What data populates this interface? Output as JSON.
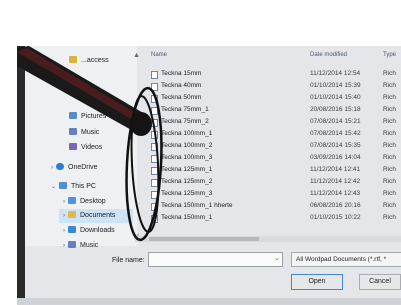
{
  "nav": {
    "items": [
      {
        "label": "...access",
        "color": "#d9b23c"
      },
      {
        "label": "Pictures",
        "color": "#5a8bc9"
      },
      {
        "label": "Music",
        "color": "#6a7fbf"
      },
      {
        "label": "Videos",
        "color": "#7b65b5"
      },
      {
        "label": "OneDrive",
        "color": "#2a7fd4"
      },
      {
        "label": "This PC",
        "color": "#4f8ed6"
      },
      {
        "label": "Desktop",
        "color": "#4a96da"
      },
      {
        "label": "Documents",
        "color": "#dfb94a"
      },
      {
        "label": "Downloads",
        "color": "#3a8ad2"
      },
      {
        "label": "Music",
        "color": "#6a7fbf"
      }
    ]
  },
  "columns": {
    "name": "Name",
    "date": "Date modified",
    "type": "Type"
  },
  "files": [
    {
      "name": "Teckna 15mm",
      "date": "11/12/2014 12:54",
      "type": "Rich"
    },
    {
      "name": "Teckna 40mm",
      "date": "01/10/2014 15:39",
      "type": "Rich"
    },
    {
      "name": "Teckna 50mm",
      "date": "01/10/2014 15:40",
      "type": "Rich"
    },
    {
      "name": "Teckna 75mm_1",
      "date": "20/08/2016 15:18",
      "type": "Rich"
    },
    {
      "name": "Teckna 75mm_2",
      "date": "07/08/2014 15:21",
      "type": "Rich"
    },
    {
      "name": "Teckna 100mm_1",
      "date": "07/08/2014 15:42",
      "type": "Rich"
    },
    {
      "name": "Teckna 100mm_2",
      "date": "07/08/2014 15:35",
      "type": "Rich"
    },
    {
      "name": "Teckna 100mm_3",
      "date": "03/09/2016 14:04",
      "type": "Rich"
    },
    {
      "name": "Teckna 125mm_1",
      "date": "11/12/2014 12:41",
      "type": "Rich"
    },
    {
      "name": "Teckna 125mm_2",
      "date": "11/12/2014 12:42",
      "type": "Rich"
    },
    {
      "name": "Teckna 125mm_3",
      "date": "11/12/2014 12:43",
      "type": "Rich"
    },
    {
      "name": "Teckna 150mm_1 hherte",
      "date": "06/08/2016 20:16",
      "type": "Rich"
    },
    {
      "name": "Teckna 150mm_1",
      "date": "01/10/2015 10:22",
      "type": "Rich"
    }
  ],
  "footer": {
    "file_name_label": "File name:",
    "file_name_value": "",
    "file_type": "All Wordpad Documents (*.rtf, *",
    "open_label": "Open",
    "cancel_label": "Cancel"
  },
  "colors": {
    "selected_nav": "#cde4f7",
    "pen_dark": "#1a1a1a",
    "pen_red": "#5a1f20"
  }
}
